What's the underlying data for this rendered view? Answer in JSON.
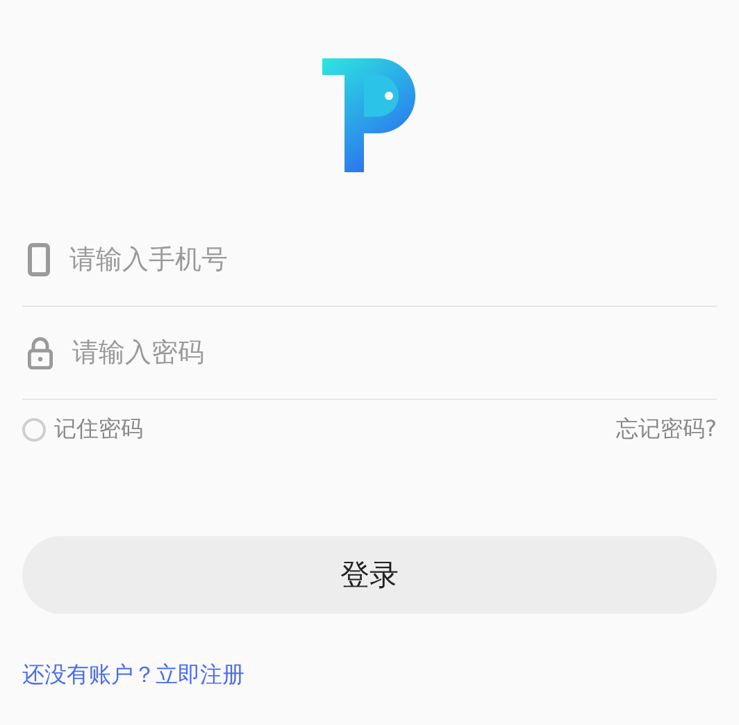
{
  "fields": [
    {
      "kind": "phone",
      "placeholder": "请输入手机号"
    },
    {
      "kind": "password",
      "placeholder": "请输入密码"
    }
  ],
  "remember": {
    "label": "记住密码",
    "checked": false
  },
  "forgot": "忘记密码?",
  "login_button": "登录",
  "register_link": "还没有账户？立即注册"
}
